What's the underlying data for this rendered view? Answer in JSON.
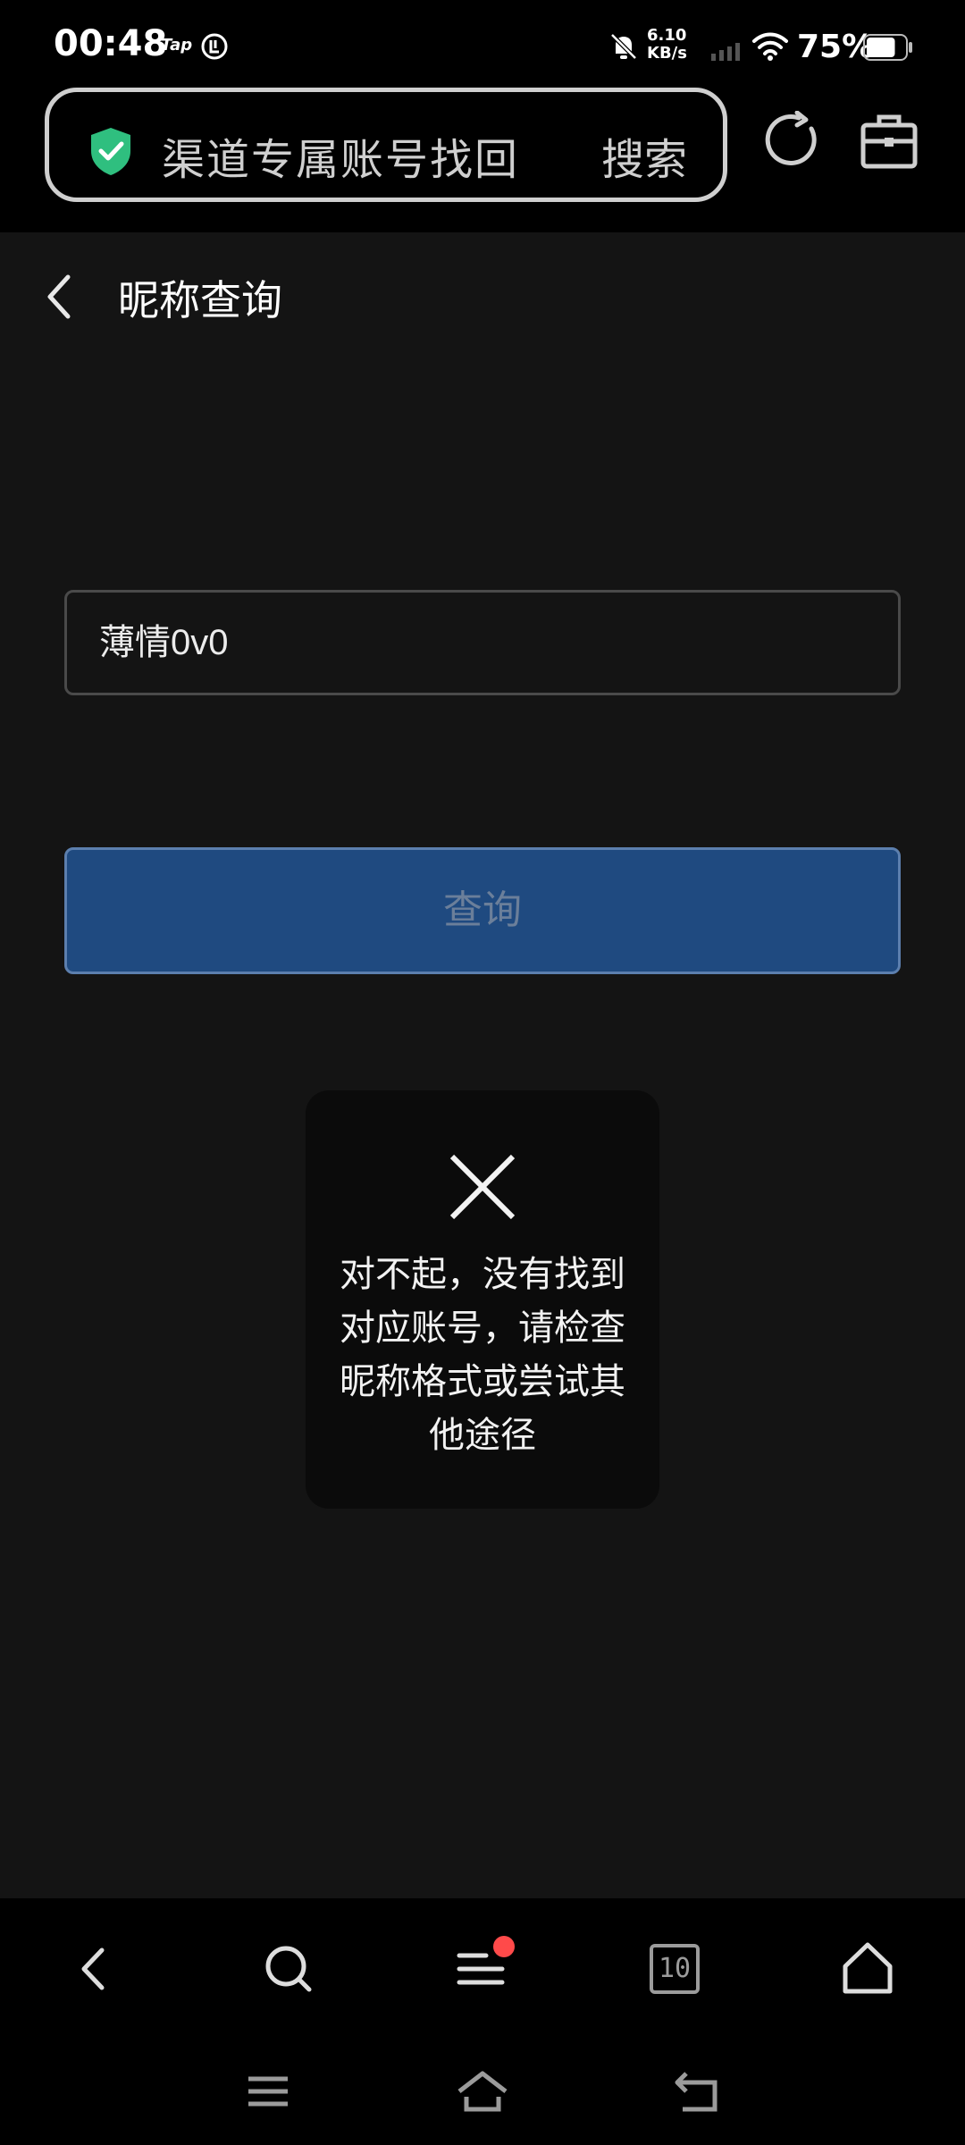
{
  "status_bar": {
    "time": "00:48",
    "app_badge": "Tap",
    "net_speed_value": "6.10",
    "net_speed_unit": "KB/s",
    "battery_percent": "75%",
    "battery_level": 0.75
  },
  "address_bar": {
    "query": "渠道专属账号找回",
    "search_label": "搜索"
  },
  "page": {
    "title": "昵称查询",
    "nickname_value": "薄情0v0",
    "query_button_label": "查询"
  },
  "toast": {
    "message": "对不起，没有找到对应账号，请检查昵称格式或尝试其他途径"
  },
  "browser_nav": {
    "tab_count": "10",
    "menu_has_notification": true
  },
  "colors": {
    "accent_button": "#1f4a80",
    "shield_green": "#2fbf7f",
    "notification_red": "#ff4a4a",
    "page_background": "#141414"
  }
}
